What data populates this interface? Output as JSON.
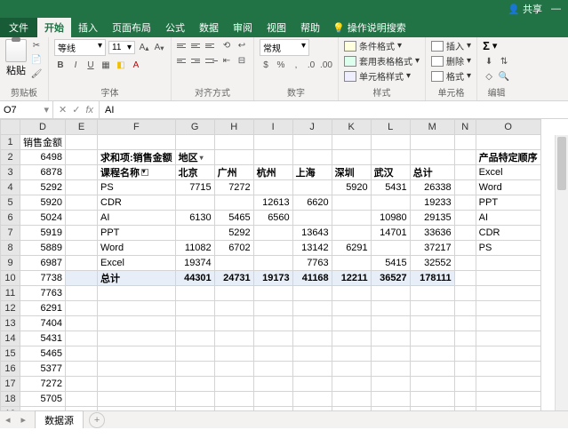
{
  "titlebar": {
    "share": "共享"
  },
  "tabs": {
    "file": "文件",
    "home": "开始",
    "insert": "插入",
    "layout": "页面布局",
    "formulas": "公式",
    "data": "数据",
    "review": "审阅",
    "view": "视图",
    "help": "帮助",
    "tellme": "操作说明搜索"
  },
  "ribbon": {
    "paste": "粘贴",
    "clipboard": "剪贴板",
    "font_name": "等线",
    "font_size": "11",
    "font_group": "字体",
    "align_group": "对齐方式",
    "number_format": "常规",
    "number_group": "数字",
    "cond_fmt": "条件格式",
    "table_fmt": "套用表格格式",
    "cell_styles": "单元格样式",
    "styles_group": "样式",
    "insert_cells": "插入",
    "delete_cells": "删除",
    "format_cells": "格式",
    "cells_group": "单元格",
    "editing_group": "编辑"
  },
  "formula_bar": {
    "name_box": "O7",
    "fx_value": "AI"
  },
  "cols": [
    "D",
    "E",
    "F",
    "G",
    "H",
    "I",
    "J",
    "K",
    "L",
    "M",
    "N",
    "O"
  ],
  "row_start": 1,
  "left_header": "销售金额",
  "left_values": [
    "6498",
    "6878",
    "5292",
    "5920",
    "5024",
    "5919",
    "5889",
    "6987",
    "7738",
    "7763",
    "6291",
    "7404",
    "5431",
    "5465",
    "5377",
    "7272",
    "5705"
  ],
  "pivot": {
    "sum_label": "求和项:销售金额",
    "region_label": "地区",
    "row_label": "课程名称",
    "col_headers": [
      "北京",
      "广州",
      "杭州",
      "上海",
      "深圳",
      "武汉",
      "总计"
    ],
    "rows": [
      {
        "name": "PS",
        "v": [
          "7715",
          "7272",
          "",
          "",
          "5920",
          "5431",
          "26338"
        ]
      },
      {
        "name": "CDR",
        "v": [
          "",
          "",
          "12613",
          "6620",
          "",
          "",
          "19233"
        ]
      },
      {
        "name": "AI",
        "v": [
          "6130",
          "5465",
          "6560",
          "",
          "",
          "10980",
          "29135"
        ]
      },
      {
        "name": "PPT",
        "v": [
          "",
          "5292",
          "",
          "13643",
          "",
          "14701",
          "33636"
        ]
      },
      {
        "name": "Word",
        "v": [
          "11082",
          "6702",
          "",
          "13142",
          "6291",
          "",
          "37217"
        ]
      },
      {
        "name": "Excel",
        "v": [
          "19374",
          "",
          "",
          "7763",
          "",
          "5415",
          "32552"
        ]
      }
    ],
    "total_label": "总计",
    "totals": [
      "44301",
      "24731",
      "19173",
      "41168",
      "12211",
      "36527",
      "178111"
    ]
  },
  "right": {
    "header": "产品特定顺序",
    "items": [
      "Excel",
      "Word",
      "PPT",
      "AI",
      "CDR",
      "PS"
    ]
  },
  "sheet_tabs": {
    "active": "数据源"
  }
}
